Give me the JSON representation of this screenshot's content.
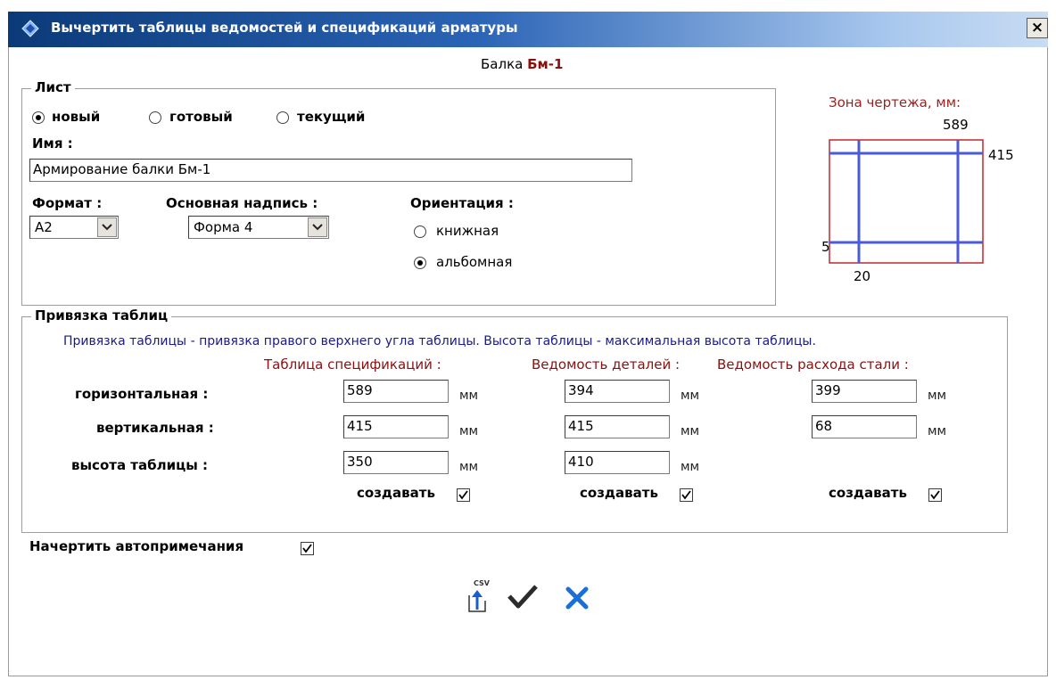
{
  "window": {
    "title": "Вычертить таблицы ведомостей и спецификаций арматуры",
    "close_label": "×"
  },
  "header": {
    "prefix": "Балка",
    "name": "Бм-1"
  },
  "sheet": {
    "legend": "Лист",
    "radios": [
      {
        "label": "новый",
        "checked": true
      },
      {
        "label": "готовый",
        "checked": false
      },
      {
        "label": "текущий",
        "checked": false
      }
    ],
    "name_label": "Имя :",
    "name_value": "Армирование балки Бм-1",
    "format_label": "Формат :",
    "format_value": "А2",
    "stamp_label": "Основная надпись :",
    "stamp_value": "Форма 4",
    "orientation_label": "Ориентация :",
    "orientation_options": [
      {
        "label": "книжная",
        "checked": false
      },
      {
        "label": "альбомная",
        "checked": true
      }
    ]
  },
  "zone": {
    "title": "Зона чертежа, мм:",
    "width": "589",
    "height": "415",
    "margin_bottom": "5",
    "margin_left": "20",
    "frame_color": "#c0282d",
    "line_color": "#4a5ad8"
  },
  "tables": {
    "legend": "Привязка таблиц",
    "note": "Привязка таблицы - привязка правого верхнего угла таблицы. Высота таблицы - максимальная высота таблицы.",
    "row_labels": [
      "горизонтальная :",
      "вертикальная :",
      "высота таблицы :"
    ],
    "unit": "мм",
    "create_label": "создавать",
    "columns": [
      {
        "title": "Таблица спецификаций :",
        "horizontal": "589",
        "vertical": "415",
        "height": "350",
        "create": true
      },
      {
        "title": "Ведомость деталей :",
        "horizontal": "394",
        "vertical": "415",
        "height": "410",
        "create": true
      },
      {
        "title": "Ведомость расхода стали :",
        "horizontal": "399",
        "vertical": "68",
        "create": true
      }
    ]
  },
  "autonotes": {
    "label": "Начертить автопримечания",
    "checked": true
  },
  "actions": {
    "csv_label": "CSV",
    "csv_icon": "csv-export-icon",
    "ok_icon": "checkmark-icon",
    "cancel_icon": "cross-icon"
  }
}
